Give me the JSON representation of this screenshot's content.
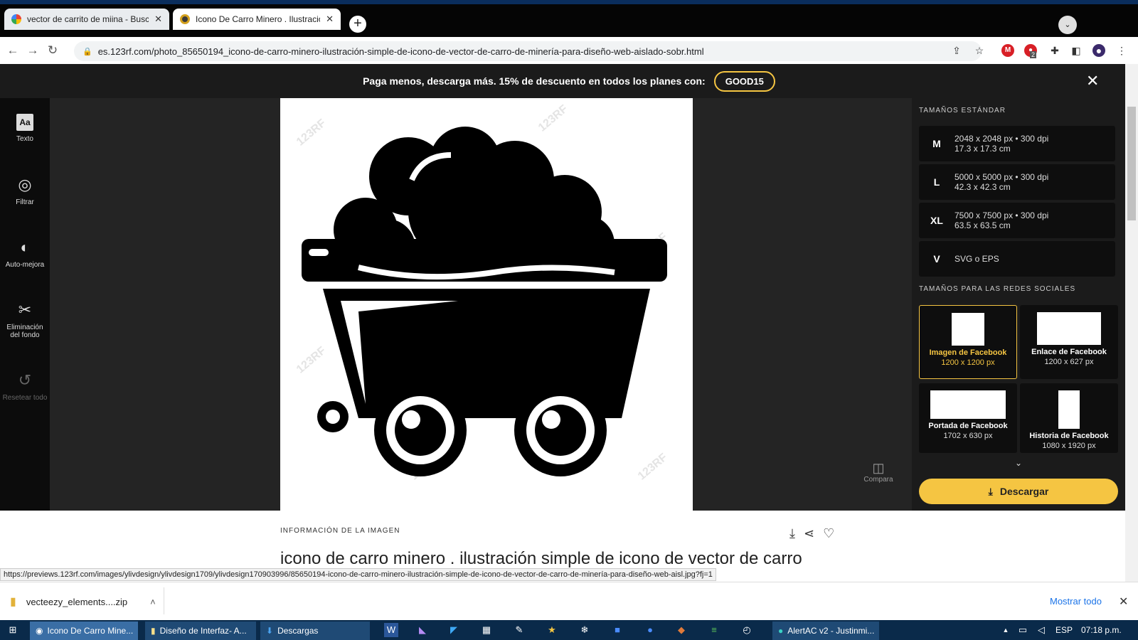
{
  "browser": {
    "tabs": [
      {
        "title": "vector de carrito de miina - Busca",
        "close": "✕"
      },
      {
        "title": "Icono De Carro Minero . Ilustracio",
        "close": "✕"
      }
    ],
    "new_tab": "+",
    "tab_search": "⌄",
    "url": "es.123rf.com/photo_85650194_icono-de-carro-minero-ilustración-simple-de-icono-de-vector-de-carro-de-minería-para-diseño-web-aislado-sobr.html",
    "ext_badge": "2"
  },
  "banner": {
    "text": "Paga menos, descarga más. 15% de descuento en todos los planes con:",
    "coupon": "GOOD15",
    "close": "✕"
  },
  "tools": [
    {
      "label": "Texto",
      "icon": "text-icon"
    },
    {
      "label": "Filtrar",
      "icon": "filter-icon"
    },
    {
      "label": "Auto-mejora",
      "icon": "auto-enhance-icon"
    },
    {
      "label": "Eliminación del fondo",
      "icon": "scissors-icon"
    },
    {
      "label": "Resetear todo",
      "icon": "reset-icon"
    }
  ],
  "watermark": "123RF",
  "compare_label": "Compara",
  "panel": {
    "standard_heading": "TAMAÑOS ESTÁNDAR",
    "sizes": [
      {
        "key": "M",
        "line1": "2048 x 2048 px • 300 dpi",
        "line2": "17.3 x 17.3 cm"
      },
      {
        "key": "L",
        "line1": "5000 x 5000 px • 300 dpi",
        "line2": "42.3 x 42.3 cm"
      },
      {
        "key": "XL",
        "line1": "7500 x 7500 px • 300 dpi",
        "line2": "63.5 x 63.5 cm"
      },
      {
        "key": "V",
        "line1": "SVG o EPS",
        "line2": ""
      }
    ],
    "social_heading": "TAMAÑOS PARA LAS REDES SOCIALES",
    "social": [
      {
        "name": "Imagen de Facebook",
        "px": "1200 x 1200 px",
        "selected": true
      },
      {
        "name": "Enlace de Facebook",
        "px": "1200 x 627 px",
        "selected": false
      },
      {
        "name": "Portada de Facebook",
        "px": "1702 x 630 px",
        "selected": false
      },
      {
        "name": "Historia de Facebook",
        "px": "1080 x 1920 px",
        "selected": false
      }
    ],
    "more": "⌄",
    "download": "Descargar",
    "accent": "#f5c542"
  },
  "info": {
    "label": "INFORMACIÓN DE LA IMAGEN",
    "title": "icono de carro minero . ilustración simple de icono de vector de carro"
  },
  "status_url": "https://previews.123rf.com/images/ylivdesign/ylivdesign1709/ylivdesign170903996/85650194-icono-de-carro-minero-ilustración-simple-de-icono-de-vector-de-carro-de-minería-para-diseño-web-aisl.jpg?fj=1",
  "downloads": {
    "file": "vecteezy_elements....zip",
    "show_all": "Mostrar todo",
    "close": "✕"
  },
  "taskbar": {
    "items": [
      "Icono De Carro Mine...",
      "Diseño de Interfaz- A...",
      "Descargas",
      "AlertAC v2 - Justinmi..."
    ],
    "lang": "ESP",
    "time": "07:18 p.m."
  }
}
